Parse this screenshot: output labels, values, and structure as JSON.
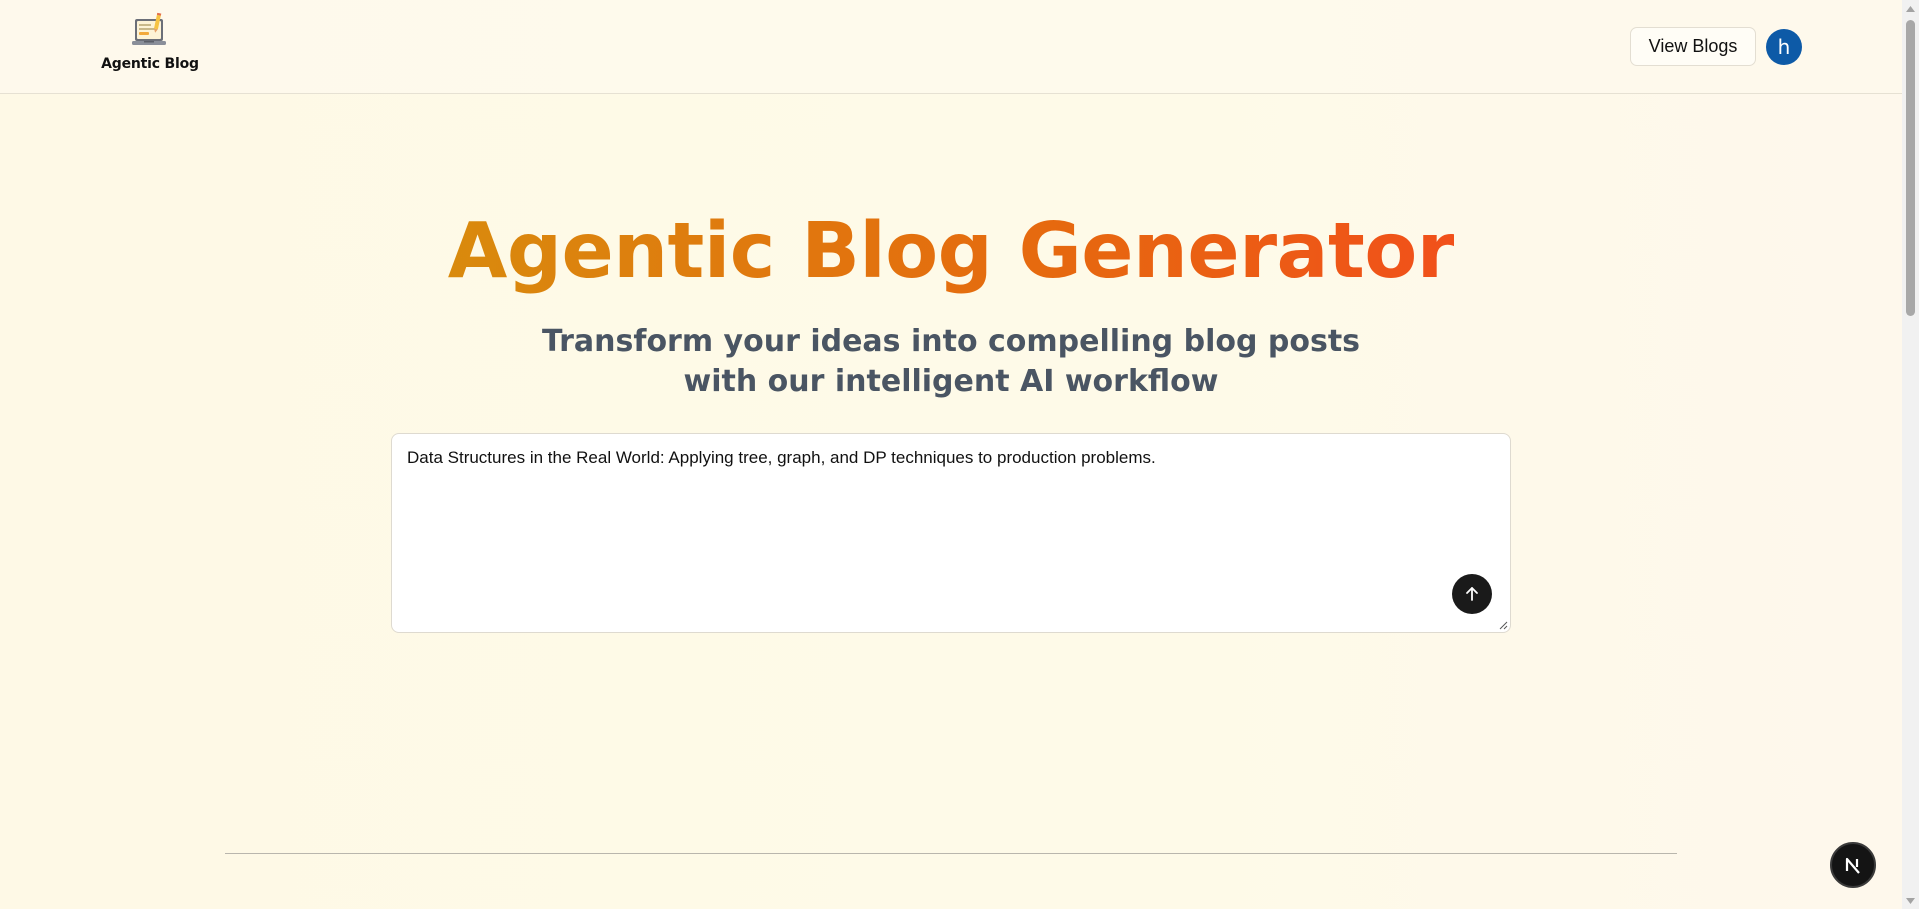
{
  "header": {
    "logo_text": "Agentic Blog",
    "view_blogs_label": "View Blogs",
    "avatar_initial": "h"
  },
  "hero": {
    "title": "Agentic Blog Generator",
    "subtitle_line1": "Transform your ideas into compelling blog posts",
    "subtitle_line2": "with our intelligent AI workflow"
  },
  "prompt": {
    "value": "Data Structures in the Real World: Applying tree, graph, and DP techniques to production problems."
  },
  "icons": {
    "logo": "laptop-pencil-icon",
    "send": "arrow-up-icon",
    "next_badge": "nextjs-logo-icon"
  },
  "colors": {
    "title_gradient_start": "#d98a0d",
    "title_gradient_end": "#f1501a",
    "subtitle": "#4a5563",
    "avatar_bg": "#0d5aa7",
    "send_button_bg": "#1a1a1a",
    "page_bg": "#fefaea"
  }
}
